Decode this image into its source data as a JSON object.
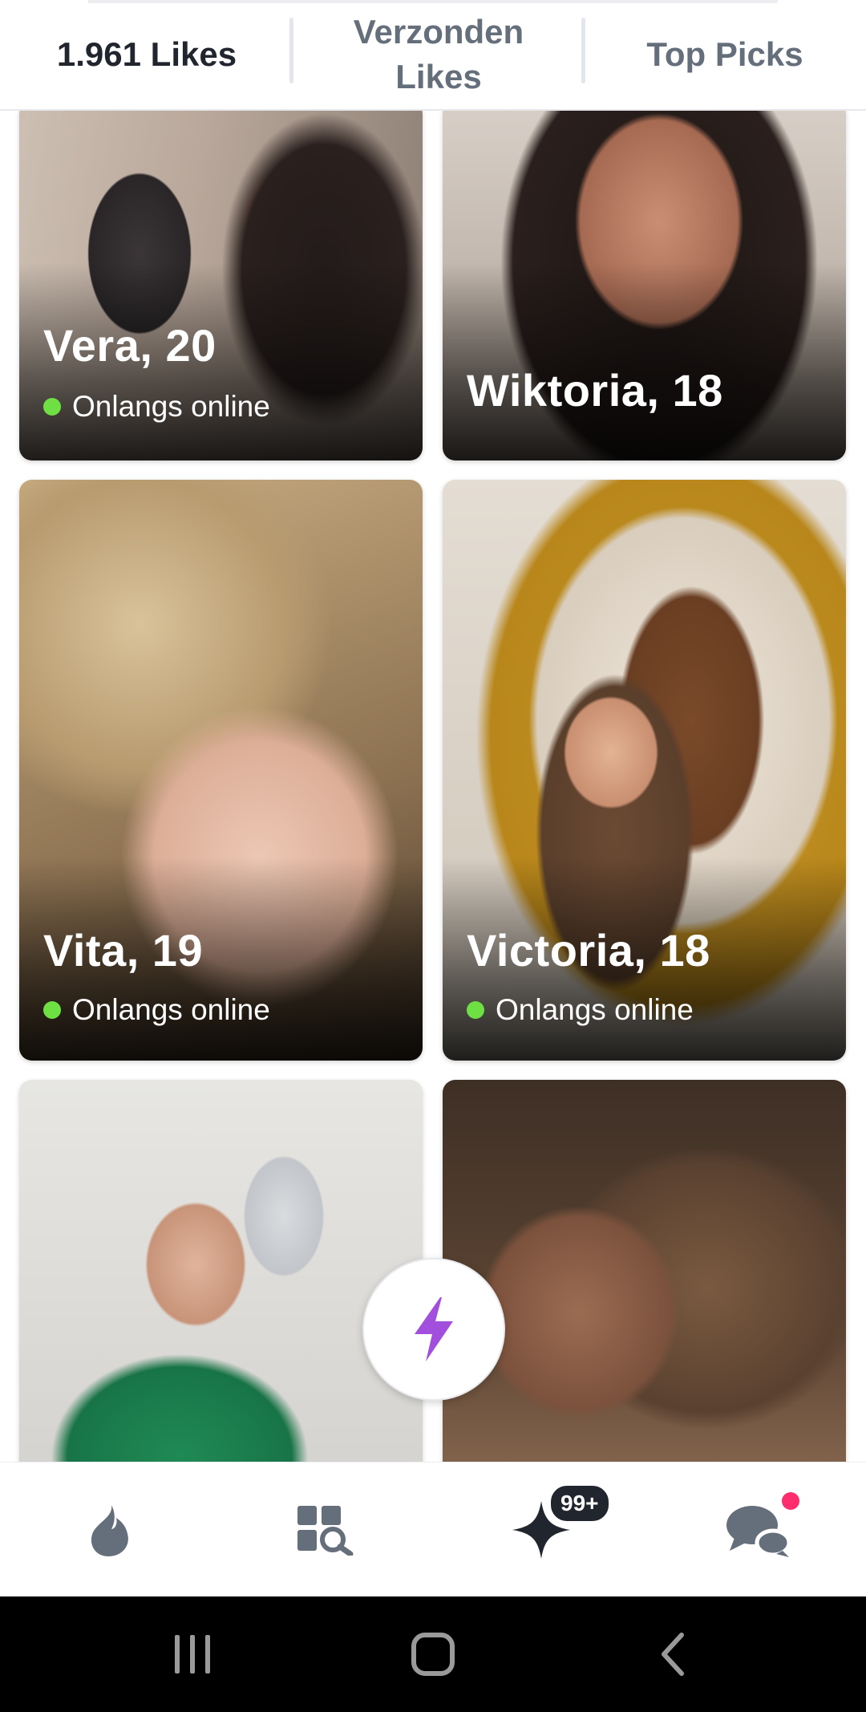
{
  "tabs": {
    "likes": "1.961 Likes",
    "sent_line1": "Verzonden",
    "sent_line2": "Likes",
    "top_picks": "Top Picks"
  },
  "profiles": [
    {
      "name": "Vera, 20",
      "status": "Onlangs online"
    },
    {
      "name": "Wiktoria, 18",
      "status": ""
    },
    {
      "name": "Vita, 19",
      "status": "Onlangs online"
    },
    {
      "name": "Victoria, 18",
      "status": "Onlangs online"
    },
    {
      "name": "",
      "status": ""
    },
    {
      "name": "",
      "status": ""
    }
  ],
  "boost": {
    "icon": "lightning-icon",
    "color": "#a34fde"
  },
  "bottom_nav": {
    "items": [
      {
        "icon": "flame-icon"
      },
      {
        "icon": "explore-grid-icon"
      },
      {
        "icon": "sparkle-icon",
        "badge": "99+"
      },
      {
        "icon": "chat-bubbles-icon",
        "notification": true
      }
    ]
  },
  "colors": {
    "active_tab": "#21262e",
    "inactive_tab": "#656e7b",
    "online_dot": "#6ee044",
    "notification": "#ff2d6e",
    "nav_icon": "#656e7b"
  },
  "system_nav": [
    "recent-apps-icon",
    "home-icon",
    "back-icon"
  ]
}
